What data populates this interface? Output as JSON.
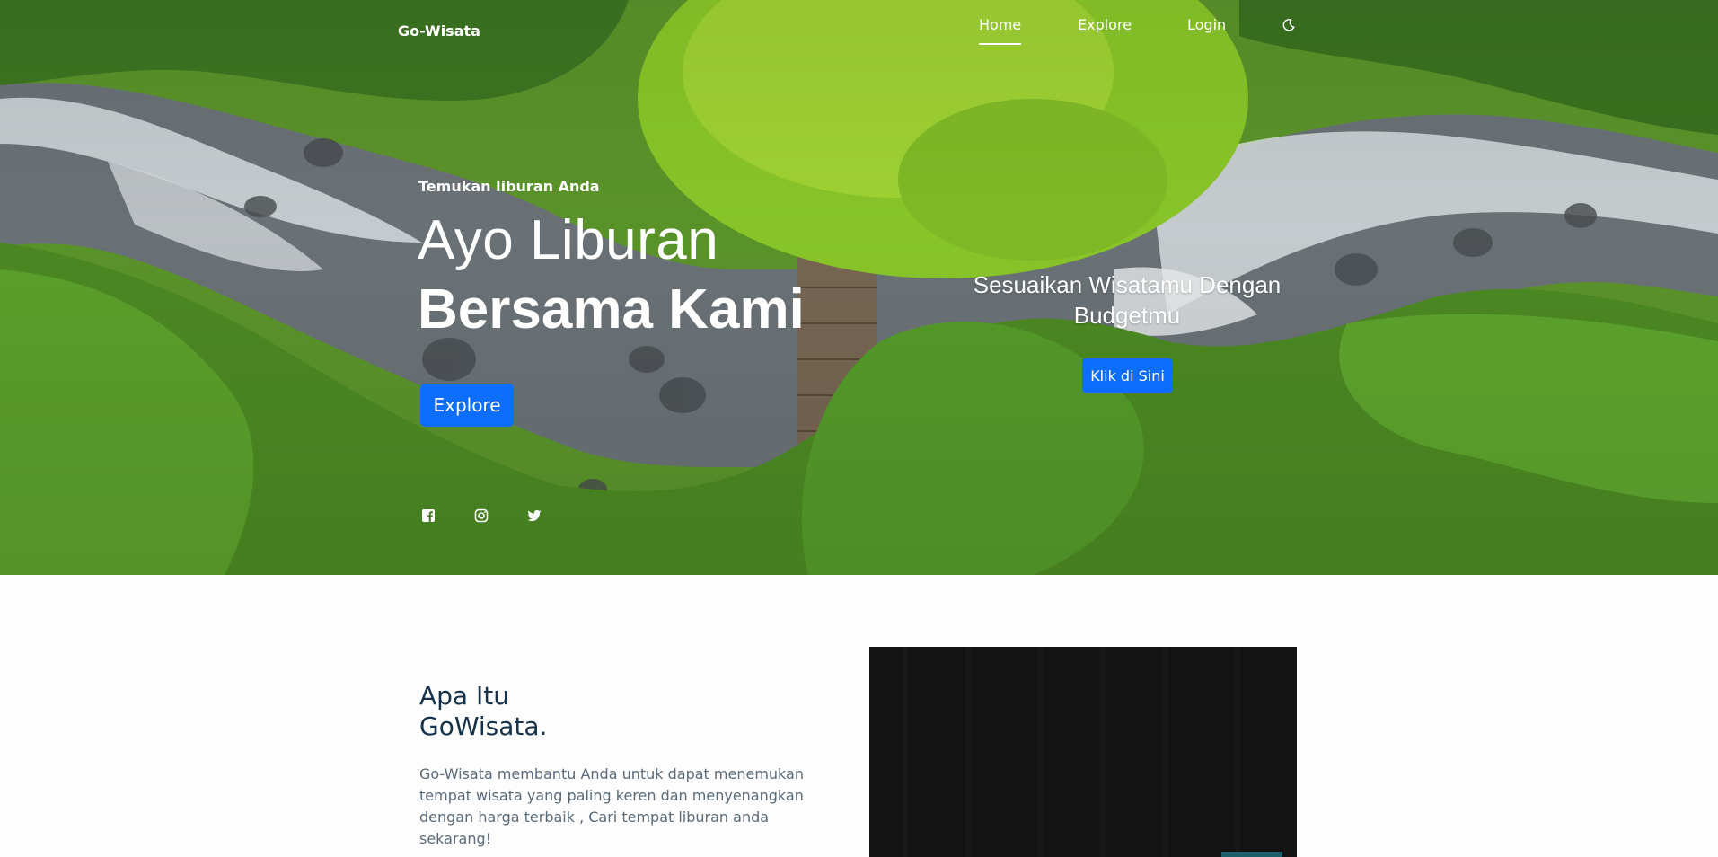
{
  "nav": {
    "brand": "Go-Wisata",
    "items": [
      "Home",
      "Explore",
      "Login"
    ],
    "active": "Home",
    "theme_icon": "moon-icon"
  },
  "hero": {
    "kicker": "Temukan liburan Anda",
    "title_line1": "Ayo Liburan",
    "title_line2": "Bersama Kami",
    "explore_label": "Explore",
    "promo_text": "Sesuaikan Wisatamu Dengan Budgetmu",
    "promo_button": "Klik di Sini",
    "social_icons": [
      "facebook-icon",
      "instagram-icon",
      "twitter-icon"
    ]
  },
  "about": {
    "title_line1": "Apa Itu",
    "title_line2": "GoWisata.",
    "description": "Go-Wisata membantu Anda untuk dapat menemukan tempat wisata yang paling keren dan menyenangkan dengan harga terbaik , Cari tempat liburan anda sekarang!"
  },
  "colors": {
    "primary": "#0d6efd",
    "heading": "#16324a",
    "body_text": "#5a6b7b",
    "video_bg": "#141313"
  }
}
